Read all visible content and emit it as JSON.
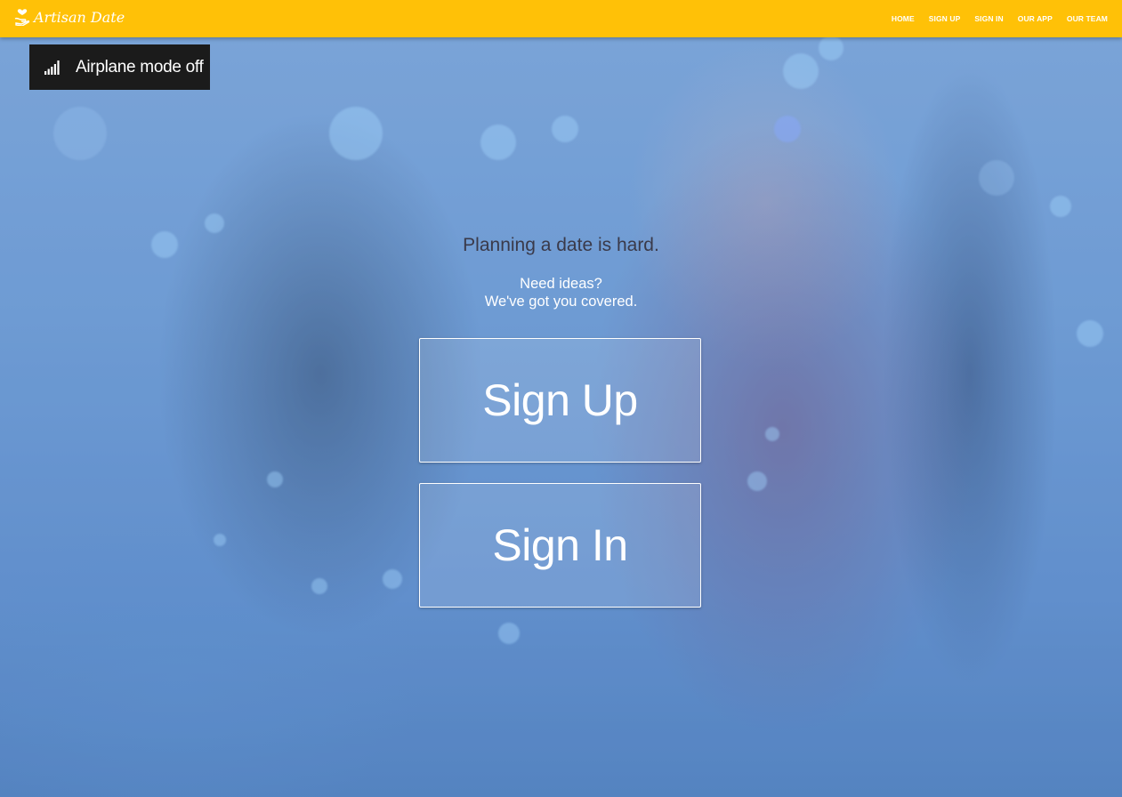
{
  "navbar": {
    "brand": "Artisan Date",
    "brand_icon": "heart-hand-icon",
    "color": "#ffc107",
    "links": [
      "HOME",
      "SIGN UP",
      "SIGN IN",
      "OUR APP",
      "OUR TEAM"
    ]
  },
  "toast": {
    "icon": "signal-bars-icon",
    "text": "Airplane mode off"
  },
  "hero": {
    "tagline": "Planning a date is hard.",
    "sub1": "Need ideas?",
    "sub2": "We've got you covered.",
    "signup_button": "Sign Up",
    "signin_button": "Sign In"
  }
}
